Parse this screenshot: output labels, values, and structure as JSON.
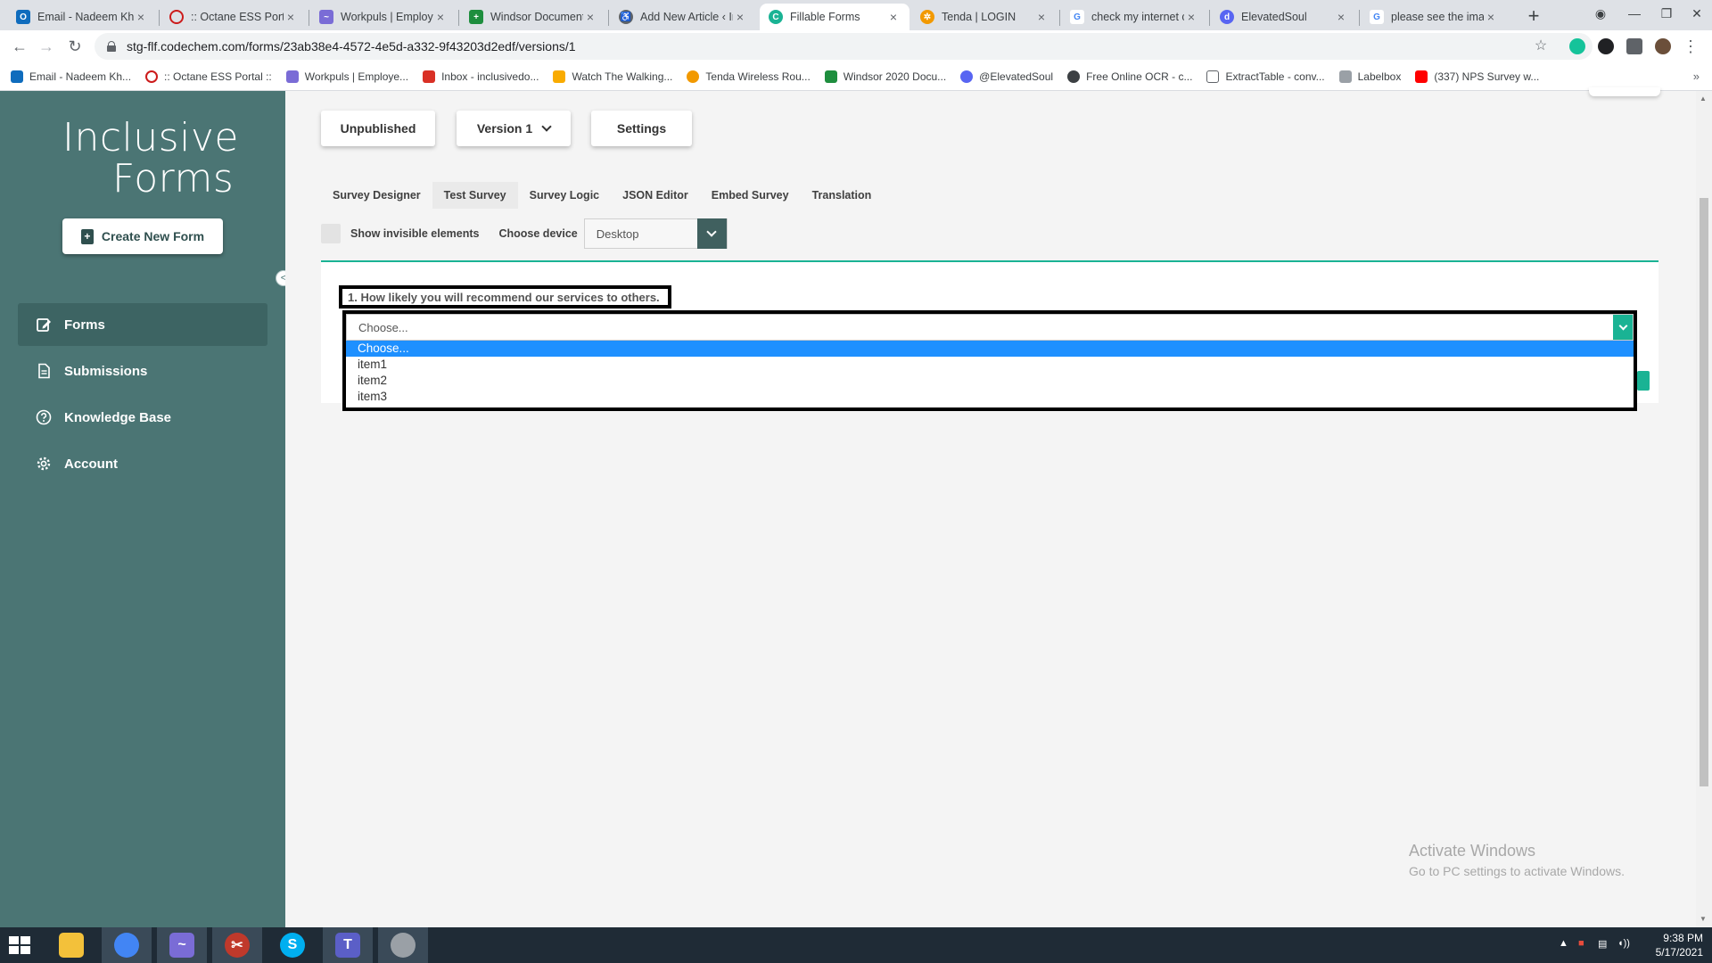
{
  "browser": {
    "tabs": [
      {
        "label": "Email - Nadeem Kh",
        "icon": "outlook-icon",
        "color": "#0f6cbd"
      },
      {
        "label": ":: Octane ESS Portal ::",
        "icon": "opera-icon",
        "color": "#cc1b1b"
      },
      {
        "label": "Workpuls | Employee",
        "icon": "workpuls-icon",
        "color": "#7a6cd6"
      },
      {
        "label": "Windsor Document",
        "icon": "sheets-icon",
        "color": "#1e8e3e"
      },
      {
        "label": "Add New Article ‹ In",
        "icon": "accessibility-icon",
        "color": "#5f6368"
      },
      {
        "label": "Fillable Forms",
        "icon": "fillable-forms-icon",
        "color": "#1ab394"
      },
      {
        "label": "Tenda | LOGIN",
        "icon": "tenda-icon",
        "color": "#f29900"
      },
      {
        "label": "check my internet c",
        "icon": "google-icon",
        "color": "#4285f4"
      },
      {
        "label": "ElevatedSoul",
        "icon": "discord-icon",
        "color": "#5865f2"
      },
      {
        "label": "please see the imag",
        "icon": "google-icon",
        "color": "#4285f4"
      }
    ],
    "active_tab": 5,
    "new_tab": "+",
    "url": "stg-flf.codechem.com/forms/23ab38e4-4572-4e5d-a332-9f43203d2edf/versions/1",
    "bookmarks": [
      {
        "label": "Email - Nadeem Kh...",
        "color": "#0f6cbd"
      },
      {
        "label": ":: Octane ESS Portal ::",
        "color": "#cc1b1b"
      },
      {
        "label": "Workpuls | Employe...",
        "color": "#7a6cd6"
      },
      {
        "label": "Inbox - inclusivedo...",
        "color": "#d93025"
      },
      {
        "label": "Watch The Walking...",
        "color": "#f9ab00"
      },
      {
        "label": "Tenda Wireless Rou...",
        "color": "#f29900"
      },
      {
        "label": "Windsor 2020 Docu...",
        "color": "#1e8e3e"
      },
      {
        "label": "@ElevatedSoul",
        "color": "#5865f2"
      },
      {
        "label": "Free Online OCR - c...",
        "color": "#3c4043"
      },
      {
        "label": "ExtractTable - conv...",
        "color": "#5f6368"
      },
      {
        "label": "Labelbox",
        "color": "#9aa0a6"
      },
      {
        "label": "(337) NPS Survey w...",
        "color": "#ff0000"
      }
    ],
    "more_bookmarks": "»"
  },
  "sidebar": {
    "logo_line1": "Inclusive",
    "logo_line2": "Forms",
    "create_button": "Create New Form",
    "items": [
      {
        "label": "Forms",
        "icon": "forms-icon"
      },
      {
        "label": "Submissions",
        "icon": "submissions-icon"
      },
      {
        "label": "Knowledge Base",
        "icon": "help-circle-icon"
      },
      {
        "label": "Account",
        "icon": "gear-icon"
      }
    ],
    "active_item": 0,
    "colors": {
      "background": "#4b7574",
      "active": "#3d6463"
    }
  },
  "topbar": {
    "unpublished": "Unpublished",
    "version": "Version 1",
    "settings": "Settings"
  },
  "designer_tabs": [
    "Survey Designer",
    "Test Survey",
    "Survey Logic",
    "JSON Editor",
    "Embed Survey",
    "Translation"
  ],
  "active_designer_tab": 1,
  "options": {
    "show_invisible_label": "Show invisible elements",
    "show_invisible_checked": false,
    "choose_device_label": "Choose device",
    "device_value": "Desktop"
  },
  "question": {
    "title": "1. How likely you will recommend our services to others.",
    "select_value": "Choose...",
    "options": [
      "Choose...",
      "item1",
      "item2",
      "item3"
    ],
    "highlighted_option": 0,
    "accent_color": "#1ab394",
    "highlight_color": "#1e90ff"
  },
  "watermark": {
    "line1": "Activate Windows",
    "line2": "Go to PC settings to activate Windows."
  },
  "taskbar": {
    "apps": [
      {
        "name": "file-explorer-icon",
        "color": "#f3c13a"
      },
      {
        "name": "chrome-icon",
        "color": "#4285f4"
      },
      {
        "name": "workpuls-icon",
        "color": "#7a6cd6"
      },
      {
        "name": "snipping-tool-icon",
        "color": "#c0392b"
      },
      {
        "name": "skype-icon",
        "color": "#00aff0"
      },
      {
        "name": "teams-icon",
        "color": "#5b5fc7"
      },
      {
        "name": "paint-icon",
        "color": "#9aa0a6"
      }
    ],
    "active_app": 1,
    "time": "9:38 PM",
    "date": "5/17/2021"
  }
}
